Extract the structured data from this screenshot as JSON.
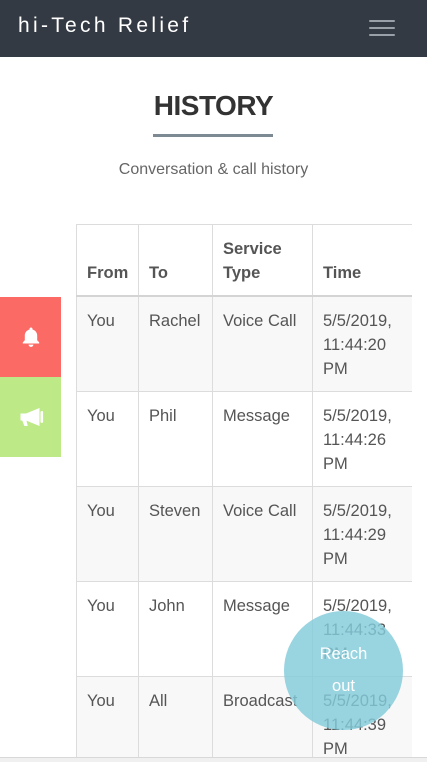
{
  "app": {
    "brand": "hi-Tech Relief"
  },
  "page": {
    "title": "HISTORY",
    "subtitle": "Conversation & call history"
  },
  "table": {
    "headers": {
      "from": "From",
      "to": "To",
      "service_type": "Service Type",
      "time": "Time"
    },
    "rows": [
      {
        "from": "You",
        "to": "Rachel",
        "service_type": "Voice Call",
        "time": "5/5/2019, 11:44:20 PM"
      },
      {
        "from": "You",
        "to": "Phil",
        "service_type": "Message",
        "time": "5/5/2019, 11:44:26 PM"
      },
      {
        "from": "You",
        "to": "Steven",
        "service_type": "Voice Call",
        "time": "5/5/2019, 11:44:29 PM"
      },
      {
        "from": "You",
        "to": "John",
        "service_type": "Message",
        "time": "5/5/2019, 11:44:33 PM"
      },
      {
        "from": "You",
        "to": "All",
        "service_type": "Broadcast",
        "time": "5/5/2019, 11:44:39 PM"
      }
    ]
  },
  "side_buttons": {
    "alert_icon": "bell-icon",
    "alert_color": "#fb6a65",
    "announce_icon": "megaphone-icon",
    "announce_color": "#bde987"
  },
  "reach_out": {
    "line1": "Reach",
    "line2": "out"
  },
  "colors": {
    "navbar": "#343a44",
    "accent_rule": "#7d8a94",
    "reach_out": "#82cbdb"
  }
}
